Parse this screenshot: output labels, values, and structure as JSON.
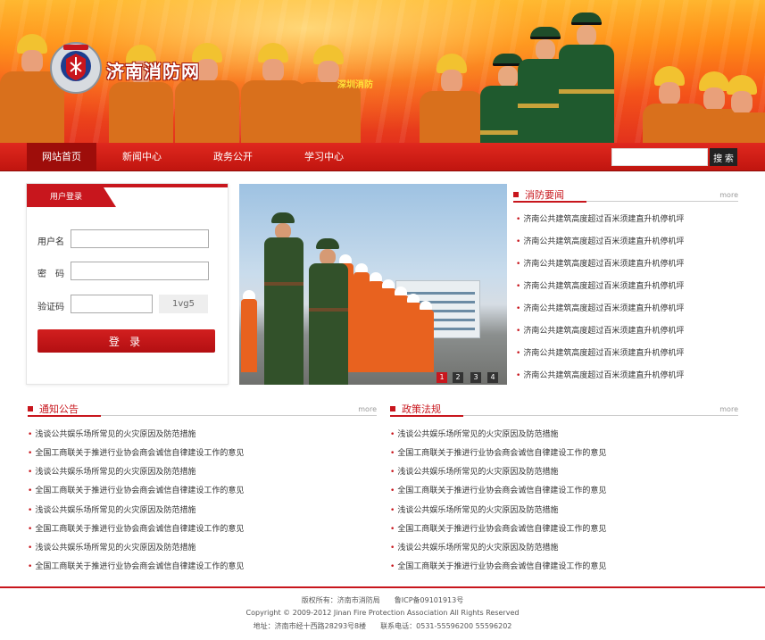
{
  "header": {
    "site_title": "济南消防网",
    "banner_sign": "深圳消防"
  },
  "nav": {
    "items": [
      "网站首页",
      "新闻中心",
      "政务公开",
      "学习中心"
    ],
    "search_button": "搜 索"
  },
  "login": {
    "tab_title": "用户登录",
    "username_label": "用户名",
    "password_label": "密　码",
    "captcha_label": "验证码",
    "captcha_code": "1vg5",
    "submit_label": "登 录"
  },
  "slideshow": {
    "dots": [
      "1",
      "2",
      "3",
      "4"
    ],
    "active_index": 1
  },
  "fire_news": {
    "title": "消防要闻",
    "more": "more",
    "items": [
      "济南公共建筑高度超过百米须建直升机停机坪",
      "济南公共建筑高度超过百米须建直升机停机坪",
      "济南公共建筑高度超过百米须建直升机停机坪",
      "济南公共建筑高度超过百米须建直升机停机坪",
      "济南公共建筑高度超过百米须建直升机停机坪",
      "济南公共建筑高度超过百米须建直升机停机坪",
      "济南公共建筑高度超过百米须建直升机停机坪",
      "济南公共建筑高度超过百米须建直升机停机坪"
    ]
  },
  "notices": {
    "title": "通知公告",
    "more": "more",
    "items": [
      "浅谈公共娱乐场所常见的火灾原因及防范措施",
      "全国工商联关于推进行业协会商会诚信自律建设工作的意见",
      "浅谈公共娱乐场所常见的火灾原因及防范措施",
      "全国工商联关于推进行业协会商会诚信自律建设工作的意见",
      "浅谈公共娱乐场所常见的火灾原因及防范措施",
      "全国工商联关于推进行业协会商会诚信自律建设工作的意见",
      "浅谈公共娱乐场所常见的火灾原因及防范措施",
      "全国工商联关于推进行业协会商会诚信自律建设工作的意见"
    ]
  },
  "policies": {
    "title": "政策法规",
    "more": "more",
    "items": [
      "浅谈公共娱乐场所常见的火灾原因及防范措施",
      "全国工商联关于推进行业协会商会诚信自律建设工作的意见",
      "浅谈公共娱乐场所常见的火灾原因及防范措施",
      "全国工商联关于推进行业协会商会诚信自律建设工作的意见",
      "浅谈公共娱乐场所常见的火灾原因及防范措施",
      "全国工商联关于推进行业协会商会诚信自律建设工作的意见",
      "浅谈公共娱乐场所常见的火灾原因及防范措施",
      "全国工商联关于推进行业协会商会诚信自律建设工作的意见"
    ]
  },
  "footer": {
    "line1": "版权所有：济南市消防局　　鲁ICP备09101913号",
    "line2": "Copyright © 2009-2012 Jinan Fire Protection  Association All Rights Reserved",
    "line3": "地址：济南市经十西路28293号8楼　　联系电话：0531-55596200 55596202"
  },
  "colors": {
    "brand_red": "#c8161d",
    "nav_active": "#9e0d0a",
    "banner_orange": "#ff8a16"
  }
}
